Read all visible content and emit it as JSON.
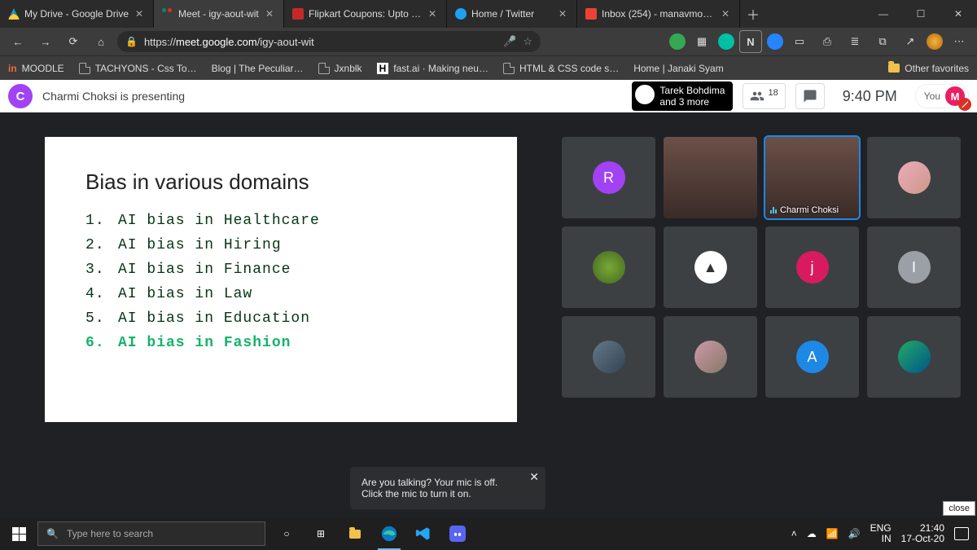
{
  "tabs": [
    {
      "title": "My Drive - Google Drive"
    },
    {
      "title": "Meet - igy-aout-wit"
    },
    {
      "title": "Flipkart Coupons: Upto 90% O"
    },
    {
      "title": "Home / Twitter"
    },
    {
      "title": "Inbox (254) - manavmodi0004"
    }
  ],
  "url": {
    "scheme": "https://",
    "host": "meet.google.com",
    "path": "/igy-aout-wit"
  },
  "bookmarks": {
    "items": [
      "MOODLE",
      "TACHYONS - Css To…",
      "Blog | The Peculiar…",
      "Jxnblk",
      "fast.ai · Making neu…",
      "HTML & CSS code s…",
      "Home | Janaki Syam"
    ],
    "other": "Other favorites"
  },
  "meet": {
    "presenter_initial": "C",
    "presenting_text": "Charmi Choksi is presenting",
    "notif_name": "Tarek Bohdima",
    "notif_sub": "and 3 more",
    "people_count": "18",
    "clock": "9:40 PM",
    "you_label": "You",
    "you_initial": "M",
    "speaker_name": "Charmi Choksi"
  },
  "slide": {
    "title": "Bias in various domains",
    "items": [
      "AI bias in Healthcare",
      "AI bias in Hiring",
      "AI bias in Finance",
      "AI bias in Law",
      "AI bias in Education",
      "AI bias in Fashion"
    ]
  },
  "tiles": {
    "r_initial": "R",
    "j_initial": "j",
    "i_initial": "I",
    "a_initial": "A"
  },
  "toast": "Are you talking? Your mic is off. Click the mic to turn it on.",
  "close_text": "close",
  "taskbar": {
    "search_placeholder": "Type here to search",
    "lang1": "ENG",
    "lang2": "IN",
    "time": "21:40",
    "date": "17-Oct-20"
  }
}
